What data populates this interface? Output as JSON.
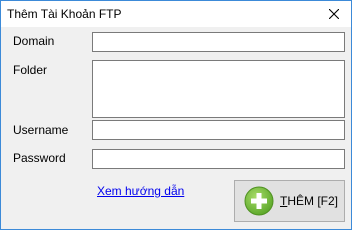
{
  "window": {
    "title": "Thêm Tài Khoản FTP",
    "close_icon": "close-icon"
  },
  "form": {
    "domain": {
      "label": "Domain",
      "value": ""
    },
    "folder": {
      "label": "Folder",
      "value": ""
    },
    "username": {
      "label": "Username",
      "value": ""
    },
    "password": {
      "label": "Password",
      "value": ""
    }
  },
  "help_link": "Xem hướng dẫn",
  "add_button": {
    "label_first": "T",
    "label_rest": "HÊM [F2]",
    "icon": "plus-circle-icon",
    "icon_color": "#7cc242"
  }
}
